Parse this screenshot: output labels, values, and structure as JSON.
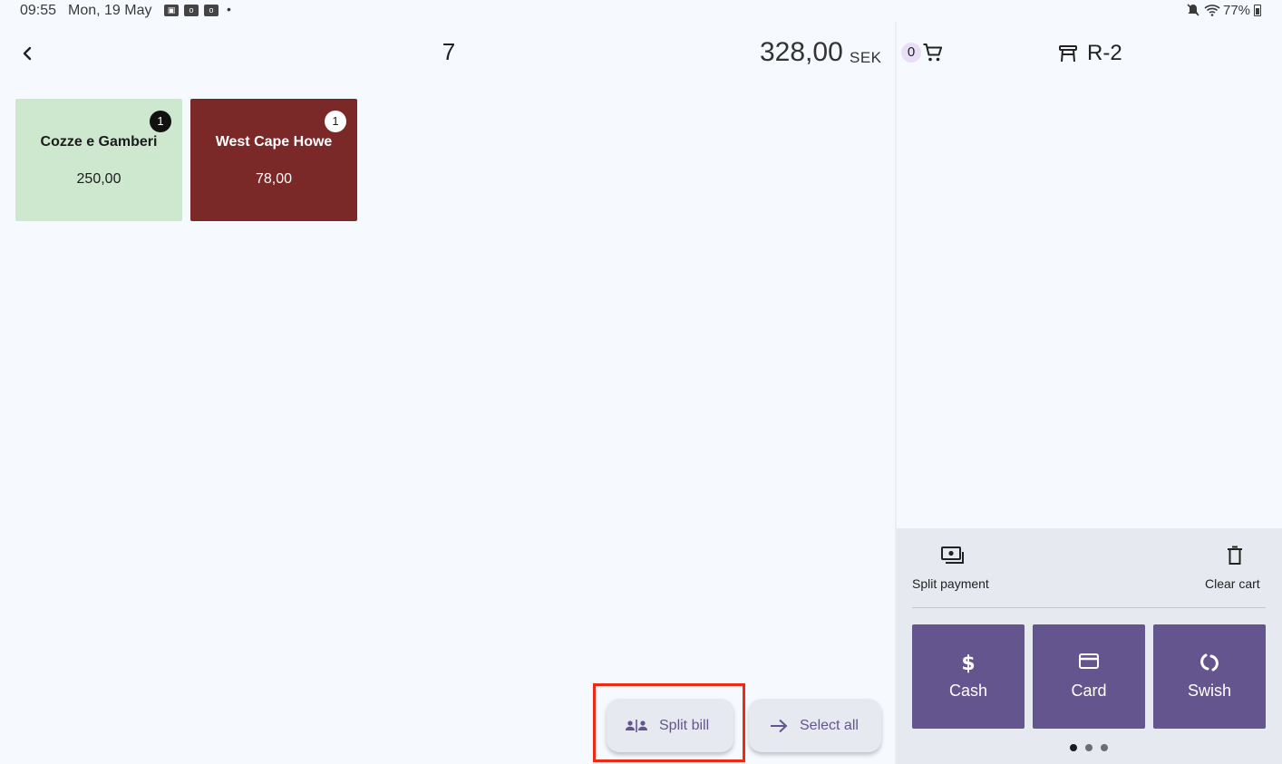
{
  "status_bar": {
    "time": "09:55",
    "date": "Mon, 19 May",
    "notification_icons": [
      "assistant-notification-icon",
      "outlook-notification-icon",
      "outlook-notification-icon"
    ],
    "more_dot": "•",
    "battery": "77%",
    "mute_icon": "muted-bell-icon",
    "wifi_icon": "wifi-icon"
  },
  "order": {
    "number": "7",
    "total": "328,00",
    "currency": "SEK"
  },
  "items": [
    {
      "name": "Cozze e Gamberi",
      "price": "250,00",
      "quantity": "1",
      "color": "#cde8cf"
    },
    {
      "name": "West Cape Howe",
      "price": "78,00",
      "quantity": "1",
      "color": "#7b2829"
    }
  ],
  "actions": {
    "split_bill": "Split bill",
    "select_all": "Select all"
  },
  "cart": {
    "count": "0",
    "table": "R-2"
  },
  "tray": {
    "split_payment": "Split payment",
    "clear_cart": "Clear cart"
  },
  "payment_methods": [
    {
      "label": "Cash",
      "icon": "dollar-icon"
    },
    {
      "label": "Card",
      "icon": "credit-card-icon"
    },
    {
      "label": "Swish",
      "icon": "swish-icon"
    }
  ],
  "pager": {
    "pages": 3,
    "current": 1
  },
  "colors": {
    "accent": "#65558f",
    "highlight": "#ee2a14",
    "background": "#f6f9fd",
    "tray": "#e6e9ef"
  }
}
